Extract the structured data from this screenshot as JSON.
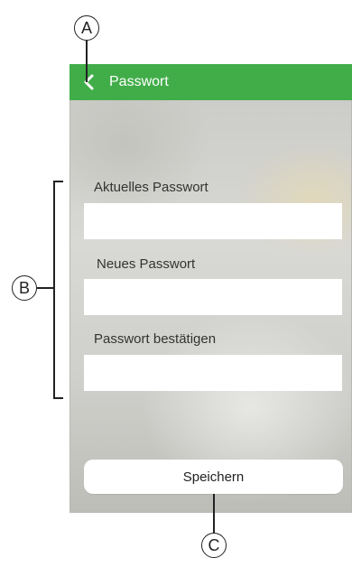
{
  "header": {
    "title": "Passwort",
    "back_icon": "chevron-left-icon",
    "color": "#41ad49"
  },
  "form": {
    "current_password": {
      "label": "Aktuelles Passwort",
      "value": ""
    },
    "new_password": {
      "label": "Neues Passwort",
      "value": ""
    },
    "confirm_password": {
      "label": "Passwort bestätigen",
      "value": ""
    }
  },
  "save_button": {
    "label": "Speichern"
  },
  "callouts": {
    "a": "A",
    "b": "B",
    "c": "C"
  }
}
